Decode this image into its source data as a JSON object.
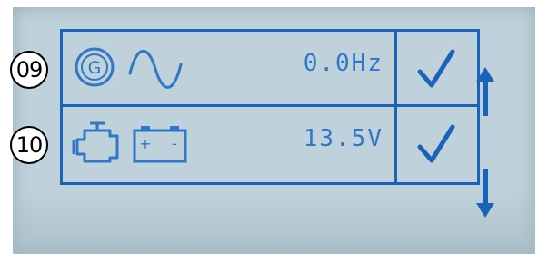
{
  "rows": [
    {
      "marker": "09",
      "icons": [
        "generator-icon",
        "sine-wave-icon"
      ],
      "generator_letter": "G",
      "value": "0.0Hz",
      "status": "check-icon"
    },
    {
      "marker": "10",
      "icons": [
        "engine-icon",
        "battery-icon"
      ],
      "battery_plus": "+",
      "battery_minus": "-",
      "value": "13.5V",
      "status": "check-icon"
    }
  ],
  "navigation": {
    "up": "arrow-up-icon",
    "down": "arrow-down-icon"
  },
  "colors": {
    "lcd_background": "#bfd1da",
    "lcd_foreground": "#1a63b8",
    "value_text": "#3077c8"
  }
}
